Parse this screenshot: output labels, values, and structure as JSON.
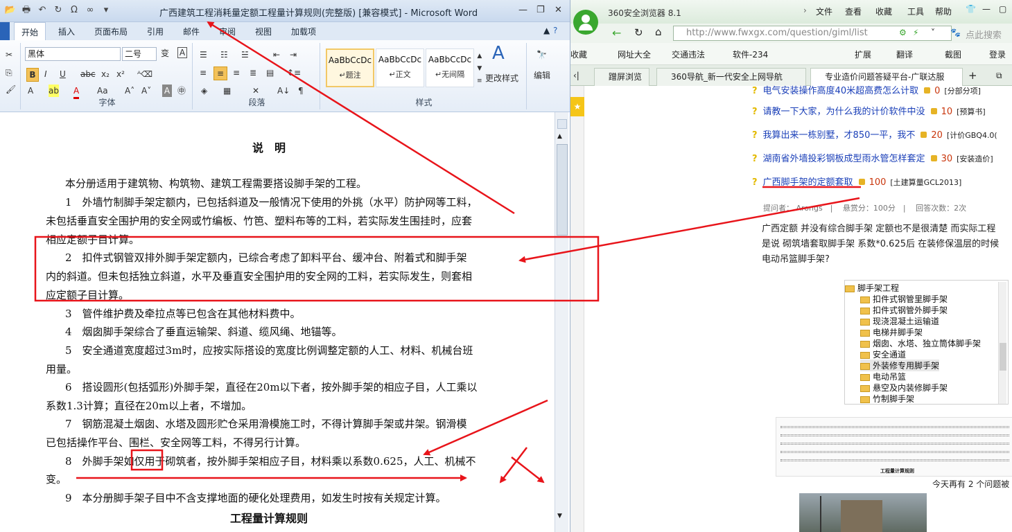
{
  "word": {
    "title": "广西建筑工程消耗量定额工程量计算规则(完整版) [兼容模式] - Microsoft Word",
    "tabs": [
      "开始",
      "插入",
      "页面布局",
      "引用",
      "邮件",
      "审阅",
      "视图",
      "加载项"
    ],
    "font_name": "黑体",
    "font_size": "二号",
    "groups": {
      "font": "字体",
      "para": "段落",
      "styles": "样式",
      "edit": "编辑"
    },
    "styles": [
      {
        "sample": "AaBbCcDc",
        "name": "↵题注"
      },
      {
        "sample": "AaBbCcDc",
        "name": "↵正文"
      },
      {
        "sample": "AaBbCcDc",
        "name": "↵无间隔"
      }
    ],
    "change_styles": "更改样式",
    "doc_lines": [
      "说　明",
      "本分册适用于建筑物、构筑物、建筑工程需要搭设脚手架的工程。",
      "1　外墙竹制脚手架定额内，已包括斜道及一般情况下使用的外挑（水平）防护网等工料，",
      "未包括垂直安全围护用的安全网或竹编板、竹笆、塑料布等的工料，若实际发生围挂时，应套",
      "相应定额子目计算。",
      "2　扣件式钢管双排外脚手架定额内，已综合考虑了卸料平台、缓冲台、附着式和脚手架",
      "内的斜道。但未包括独立斜道，水平及垂直安全围护用的安全网的工料，若实际发生，则套相",
      "应定额子目计算。",
      "3　管件维护费及牵拉点等已包含在其他材料费中。",
      "4　烟囱脚手架综合了垂直运输架、斜道、缆风绳、地锚等。",
      "5　安全通道宽度超过3m时，应按实际搭设的宽度比例调整定额的人工、材料、机械台班",
      "用量。",
      "6　搭设圆形(包括弧形)外脚手架，直径在20m以下者，按外脚手架的相应子目，人工乘以",
      "系数1.3计算；直径在20m以上者，不增加。",
      "7　钢筋混凝土烟囱、水塔及圆形贮仓采用滑模施工时，不得计算脚手架或井架。钢滑模",
      "已包括操作平台、围栏、安全网等工料，不得另行计算。",
      "8　外脚手架如仅用于砌筑者，按外脚手架相应子目，材料乘以系数0.625，人工、机械不",
      "变。",
      "9　本分册脚手架子目中不含支撑地面的硬化处理费用，如发生时按有关规定计算。",
      "工程量计算规则"
    ]
  },
  "browser": {
    "app_title": "360安全浏览器 8.1",
    "menu": [
      "文件",
      "查看",
      "收藏",
      "工具",
      "帮助"
    ],
    "url": "http://www.fwxgx.com/question/giml/list",
    "search_placeholder": "点此搜索",
    "favbar": [
      "收藏",
      "网址大全",
      "交通违法",
      "软件-234",
      "扩展",
      "翻译",
      "截图",
      "登录"
    ],
    "tabs": [
      "蹭屏浏览",
      "360导航_新一代安全上网导航",
      "专业造价问题答疑平台-广联达服"
    ],
    "questions": [
      {
        "title": "电气安装操作高度40米超高费怎么计取",
        "reward": "0",
        "cat": "[分部分项]"
      },
      {
        "title": "请教一下大家，为什么我的计价软件中没",
        "reward": "10",
        "cat": "[预算书]"
      },
      {
        "title": "我算出来一栋别墅，才850一平，我不",
        "reward": "20",
        "cat": "[计价GBQ4.0("
      },
      {
        "title": "湖南省外墙投彩钢板成型雨水管怎样套定",
        "reward": "30",
        "cat": "[安装造价]"
      },
      {
        "title": "广西脚手架的定额套取",
        "reward": "100",
        "cat": "[土建算量GCL2013]"
      }
    ],
    "meta": {
      "asker": "提问者： Arongs",
      "score": "悬赏分：100分",
      "answers": "回答次数：2次"
    },
    "question_body": [
      "广西定额 并没有综合脚手架 定额也不是很清楚 而实际工程",
      "是说 砌筑墙套取脚手架 系数*0.625后 在装修保温层的时候",
      "电动吊篮脚手架?"
    ],
    "tree": {
      "root": "脚手架工程",
      "items": [
        "扣件式钢管里脚手架",
        "扣件式钢管外脚手架",
        "现浇混凝土运输道",
        "电梯井脚手架",
        "烟囱、水塔、独立筒体脚手架",
        "安全通道",
        "外装修专用脚手架",
        "电动吊篮",
        "悬空及内装修脚手架",
        "竹制脚手架"
      ]
    },
    "thumb_caption": "工程量计算规则",
    "today": "今天再有 2 个问题被"
  },
  "colors": {
    "annotation": "#e8141a",
    "link": "#1a3fb8"
  }
}
